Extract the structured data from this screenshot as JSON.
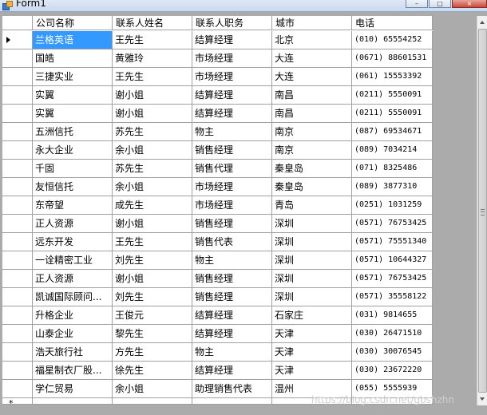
{
  "window": {
    "title": "Form1",
    "buttons": {
      "minimize": "–",
      "maximize": "□",
      "close": "×"
    }
  },
  "grid": {
    "columns": [
      "公司名称",
      "联系人姓名",
      "联系人职务",
      "城市",
      "电话"
    ],
    "selected_row": 0,
    "selected_col": 0,
    "rows": [
      [
        "兰格英语",
        "王先生",
        "结算经理",
        "北京",
        "(010) 65554252"
      ],
      [
        "国皓",
        "黄雅玲",
        "市场经理",
        "大连",
        "(0671) 88601531"
      ],
      [
        "三捷实业",
        "王先生",
        "市场经理",
        "大连",
        "(061) 15553392"
      ],
      [
        "实翼",
        "谢小姐",
        "结算经理",
        "南昌",
        "(0211) 5550091"
      ],
      [
        "实翼",
        "谢小姐",
        "结算经理",
        "南昌",
        "(0211) 5550091"
      ],
      [
        "五洲信托",
        "苏先生",
        "物主",
        "南京",
        "(087) 69534671"
      ],
      [
        "永大企业",
        "余小姐",
        "销售经理",
        "南京",
        "(089) 7034214"
      ],
      [
        "千固",
        "苏先生",
        "销售代理",
        "秦皇岛",
        "(071) 8325486"
      ],
      [
        "友恒信托",
        "余小姐",
        "市场经理",
        "秦皇岛",
        "(089) 3877310"
      ],
      [
        "东帝望",
        "成先生",
        "市场经理",
        "青岛",
        "(0251) 1031259"
      ],
      [
        "正人资源",
        "谢小姐",
        "销售经理",
        "深圳",
        "(0571) 76753425"
      ],
      [
        "远东开发",
        "王先生",
        "销售代表",
        "深圳",
        "(0571) 75551340"
      ],
      [
        "一诠精密工业",
        "刘先生",
        "物主",
        "深圳",
        "(0571) 10644327"
      ],
      [
        "正人资源",
        "谢小姐",
        "销售经理",
        "深圳",
        "(0571) 76753425"
      ],
      [
        "凯诚国际顾问...",
        "刘先生",
        "销售经理",
        "深圳",
        "(0571) 35558122"
      ],
      [
        "升格企业",
        "王俊元",
        "结算经理",
        "石家庄",
        "(031) 9814655"
      ],
      [
        "山泰企业",
        "黎先生",
        "结算经理",
        "天津",
        "(030) 26471510"
      ],
      [
        "浩天旅行社",
        "方先生",
        "物主",
        "天津",
        "(030) 30076545"
      ],
      [
        "福星制衣厂股...",
        "徐先生",
        "结算经理",
        "天津",
        "(030) 23672220"
      ],
      [
        "学仁贸易",
        "余小姐",
        "助理销售代表",
        "温州",
        "(055) 5555939"
      ]
    ],
    "new_row_marker": "*",
    "current_row_marker": "▶"
  },
  "watermark": "https://blog.csdn.net/gbshzhn",
  "colors": {
    "selection": "#3399ff",
    "gridline": "#a0a0a0",
    "background": "#ababab"
  },
  "icons": {
    "app": "form-app-icon",
    "scroll_up": "scroll-up-arrow-icon",
    "scroll_down": "scroll-down-arrow-icon"
  }
}
